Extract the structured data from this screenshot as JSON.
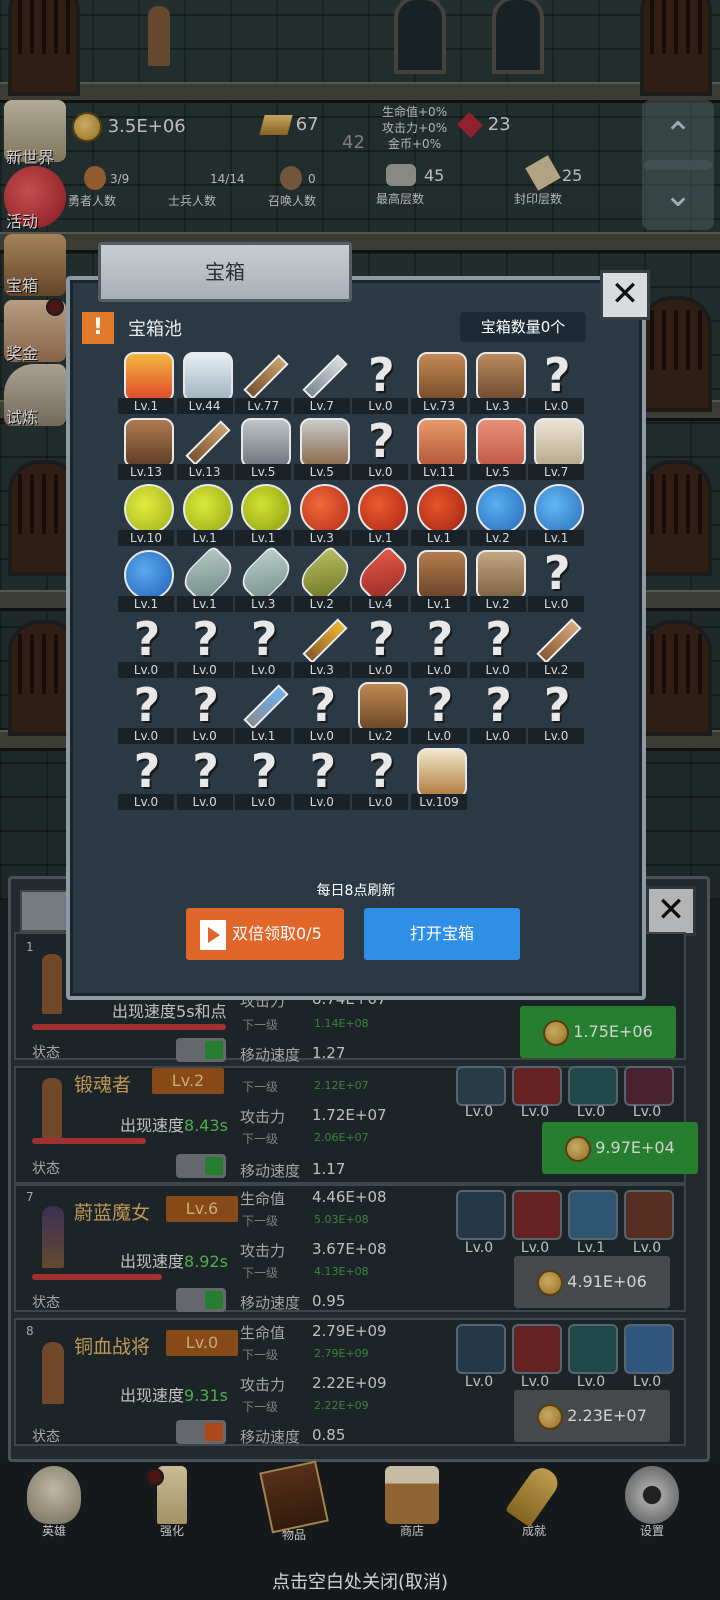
{
  "top_bar": {
    "gold": "3.5E+06",
    "bars": "67",
    "floor_num": "42",
    "gems": "23",
    "bonus_hp": "生命值+0%",
    "bonus_atk": "攻击力+0%",
    "bonus_gold": "金币+0%"
  },
  "counts": {
    "brave_val": "3/9",
    "brave_label": "勇者人数",
    "soldier_val": "14/14",
    "soldier_label": "士兵人数",
    "summon_val": "0",
    "summon_label": "召唤人数",
    "max_floor_val": "45",
    "max_floor_label": "最高层数",
    "seal_floor_val": "25",
    "seal_floor_label": "封印层数"
  },
  "side_menu": [
    "新世界",
    "活动",
    "宝箱",
    "奖金",
    "试炼"
  ],
  "modal": {
    "title": "宝箱",
    "close": "✕",
    "pool_title": "宝箱池",
    "chest_count": "宝箱数量0个",
    "refresh_note": "每日8点刷新",
    "double_btn": "双倍领取0/5",
    "open_btn": "打开宝箱",
    "items": [
      {
        "icon": "crown-icon",
        "lv": "Lv.1",
        "c1": "#f2b640",
        "c2": "#e04a2a"
      },
      {
        "icon": "diamond-icon",
        "lv": "Lv.44",
        "c1": "#e6eef3",
        "c2": "#9fb4c0"
      },
      {
        "icon": "sword-icon",
        "lv": "Lv.77",
        "c1": "#c9a06a",
        "c2": "#7a5230"
      },
      {
        "icon": "sword-icon",
        "lv": "Lv.7",
        "c1": "#d6dadf",
        "c2": "#7f8a92"
      },
      {
        "icon": "unknown-icon",
        "lv": "Lv.0",
        "c1": "#e8e8e8",
        "c2": "#9aa"
      },
      {
        "icon": "armor-icon",
        "lv": "Lv.73",
        "c1": "#c48a56",
        "c2": "#7a4c2a"
      },
      {
        "icon": "armor-icon",
        "lv": "Lv.3",
        "c1": "#b98a5e",
        "c2": "#6d4a2d"
      },
      {
        "icon": "unknown-icon",
        "lv": "Lv.0",
        "c1": "#e8e8e8",
        "c2": "#9aa"
      },
      {
        "icon": "helmet-icon",
        "lv": "Lv.13",
        "c1": "#b07a50",
        "c2": "#5e3d25"
      },
      {
        "icon": "dagger-icon",
        "lv": "Lv.13",
        "c1": "#c9a06a",
        "c2": "#7a5230"
      },
      {
        "icon": "helmet-icon",
        "lv": "Lv.5",
        "c1": "#bfc4c9",
        "c2": "#6e767d"
      },
      {
        "icon": "hammer-icon",
        "lv": "Lv.5",
        "c1": "#c9c9c9",
        "c2": "#8a6a4a"
      },
      {
        "icon": "unknown-icon",
        "lv": "Lv.0",
        "c1": "#e8e8e8",
        "c2": "#9aa"
      },
      {
        "icon": "meat-icon",
        "lv": "Lv.11",
        "c1": "#e89a6a",
        "c2": "#b5573a"
      },
      {
        "icon": "steak-icon",
        "lv": "Lv.5",
        "c1": "#e8907a",
        "c2": "#c05a48"
      },
      {
        "icon": "bread-icon",
        "lv": "Lv.7",
        "c1": "#ece4d4",
        "c2": "#b7a88c"
      },
      {
        "icon": "potion-yellow-icon",
        "lv": "Lv.10",
        "c1": "#e4ec40",
        "c2": "#9cae18"
      },
      {
        "icon": "potion-yellow-icon",
        "lv": "Lv.1",
        "c1": "#dcea3a",
        "c2": "#93a514"
      },
      {
        "icon": "potion-yellow-icon",
        "lv": "Lv.1",
        "c1": "#d2e232",
        "c2": "#8a9c12"
      },
      {
        "icon": "potion-red-icon",
        "lv": "Lv.3",
        "c1": "#f06a3a",
        "c2": "#b52c18"
      },
      {
        "icon": "potion-red-icon",
        "lv": "Lv.1",
        "c1": "#ec5a30",
        "c2": "#a82414"
      },
      {
        "icon": "potion-red-icon",
        "lv": "Lv.1",
        "c1": "#e8542c",
        "c2": "#a02212"
      },
      {
        "icon": "potion-blue-icon",
        "lv": "Lv.2",
        "c1": "#5ab2f0",
        "c2": "#2466b8"
      },
      {
        "icon": "potion-blue-icon",
        "lv": "Lv.1",
        "c1": "#62b8f4",
        "c2": "#2a6cbc"
      },
      {
        "icon": "potion-blue-icon",
        "lv": "Lv.1",
        "c1": "#5aaaf0",
        "c2": "#2260b4"
      },
      {
        "icon": "bottle-icon",
        "lv": "Lv.1",
        "c1": "#b6c8c4",
        "c2": "#6e8a84"
      },
      {
        "icon": "bottle-icon",
        "lv": "Lv.3",
        "c1": "#bcd0cc",
        "c2": "#74908a"
      },
      {
        "icon": "bottle-green-icon",
        "lv": "Lv.2",
        "c1": "#b8c060",
        "c2": "#6c7426"
      },
      {
        "icon": "bottle-red-icon",
        "lv": "Lv.4",
        "c1": "#e45a4a",
        "c2": "#9a2a22"
      },
      {
        "icon": "boot-icon",
        "lv": "Lv.1",
        "c1": "#b47c4e",
        "c2": "#6a4428"
      },
      {
        "icon": "boot-icon",
        "lv": "Lv.2",
        "c1": "#c4a682",
        "c2": "#7c6244"
      },
      {
        "icon": "unknown-icon",
        "lv": "Lv.0",
        "c1": "#e8e8e8",
        "c2": "#9aa"
      },
      {
        "icon": "unknown-icon",
        "lv": "Lv.0",
        "c1": "#e8e8e8",
        "c2": "#9aa"
      },
      {
        "icon": "unknown-icon",
        "lv": "Lv.0",
        "c1": "#e8e8e8",
        "c2": "#9aa"
      },
      {
        "icon": "unknown-icon",
        "lv": "Lv.0",
        "c1": "#e8e8e8",
        "c2": "#9aa"
      },
      {
        "icon": "torch-icon",
        "lv": "Lv.3",
        "c1": "#f2b62a",
        "c2": "#8a5a2a"
      },
      {
        "icon": "unknown-icon",
        "lv": "Lv.0",
        "c1": "#e8e8e8",
        "c2": "#9aa"
      },
      {
        "icon": "unknown-icon",
        "lv": "Lv.0",
        "c1": "#e8e8e8",
        "c2": "#9aa"
      },
      {
        "icon": "unknown-icon",
        "lv": "Lv.0",
        "c1": "#e8e8e8",
        "c2": "#9aa"
      },
      {
        "icon": "staff-icon",
        "lv": "Lv.2",
        "c1": "#d6a878",
        "c2": "#8a5a34"
      },
      {
        "icon": "unknown-icon",
        "lv": "Lv.0",
        "c1": "#e8e8e8",
        "c2": "#9aa"
      },
      {
        "icon": "unknown-icon",
        "lv": "Lv.0",
        "c1": "#e8e8e8",
        "c2": "#9aa"
      },
      {
        "icon": "wand-icon",
        "lv": "Lv.1",
        "c1": "#6ab0f0",
        "c2": "#8a8f96"
      },
      {
        "icon": "unknown-icon",
        "lv": "Lv.0",
        "c1": "#e8e8e8",
        "c2": "#9aa"
      },
      {
        "icon": "backpack-icon",
        "lv": "Lv.2",
        "c1": "#c08a52",
        "c2": "#6c4626"
      },
      {
        "icon": "unknown-icon",
        "lv": "Lv.0",
        "c1": "#e8e8e8",
        "c2": "#9aa"
      },
      {
        "icon": "unknown-icon",
        "lv": "Lv.0",
        "c1": "#e8e8e8",
        "c2": "#9aa"
      },
      {
        "icon": "unknown-icon",
        "lv": "Lv.0",
        "c1": "#e8e8e8",
        "c2": "#9aa"
      },
      {
        "icon": "unknown-icon",
        "lv": "Lv.0",
        "c1": "#e8e8e8",
        "c2": "#9aa"
      },
      {
        "icon": "unknown-icon",
        "lv": "Lv.0",
        "c1": "#e8e8e8",
        "c2": "#9aa"
      },
      {
        "icon": "unknown-icon",
        "lv": "Lv.0",
        "c1": "#e8e8e8",
        "c2": "#9aa"
      },
      {
        "icon": "unknown-icon",
        "lv": "Lv.0",
        "c1": "#e8e8e8",
        "c2": "#9aa"
      },
      {
        "icon": "unknown-icon",
        "lv": "Lv.0",
        "c1": "#e8e8e8",
        "c2": "#9aa"
      },
      {
        "icon": "beer-icon",
        "lv": "Lv.109",
        "c1": "#f2e6c8",
        "c2": "#b07a3e"
      }
    ]
  },
  "heroes": [
    {
      "rank": "1",
      "name": "",
      "speed_label": "出现速度",
      "speed_val": "5s和点",
      "atk_label": "攻击力",
      "atk": "8.74E+07",
      "atk_next_label": "下一级",
      "atk_next": "1.14E+08",
      "move_label": "移动速度",
      "move": "1.27",
      "status_label": "状态",
      "price": "1.75E+06"
    },
    {
      "rank": "",
      "name": "锻魂者",
      "level": "Lv.2",
      "speed_label": "出现速度",
      "speed_val": "8.43s",
      "hp_next_label": "下一级",
      "hp_next": "2.12E+07",
      "atk_label": "攻击力",
      "atk": "1.72E+07",
      "atk_next_label": "下一级",
      "atk_next": "2.06E+07",
      "move_label": "移动速度",
      "move": "1.17",
      "status_label": "状态",
      "skills": [
        "Lv.0",
        "Lv.0",
        "Lv.0",
        "Lv.0"
      ],
      "price": "9.97E+04"
    },
    {
      "rank": "7",
      "name": "蔚蓝魔女",
      "level": "Lv.6",
      "speed_label": "出现速度",
      "speed_val": "8.92s",
      "hp_label": "生命值",
      "hp": "4.46E+08",
      "hp_next_label": "下一级",
      "hp_next": "5.03E+08",
      "atk_label": "攻击力",
      "atk": "3.67E+08",
      "atk_next_label": "下一级",
      "atk_next": "4.13E+08",
      "move_label": "移动速度",
      "move": "0.95",
      "status_label": "状态",
      "skills": [
        "Lv.0",
        "Lv.0",
        "Lv.1",
        "Lv.0"
      ],
      "price": "4.91E+06"
    },
    {
      "rank": "8",
      "name": "铜血战将",
      "level": "Lv.0",
      "speed_label": "出现速度",
      "speed_val": "9.31s",
      "hp_label": "生命值",
      "hp": "2.79E+09",
      "hp_next_label": "下一级",
      "hp_next": "2.79E+09",
      "atk_label": "攻击力",
      "atk": "2.22E+09",
      "atk_next_label": "下一级",
      "atk_next": "2.22E+09",
      "move_label": "移动速度",
      "move": "0.85",
      "status_label": "状态",
      "skills": [
        "Lv.0",
        "Lv.0",
        "Lv.0",
        "Lv.0"
      ],
      "price": "2.23E+07"
    }
  ],
  "bottom_nav": [
    "英雄",
    "强化",
    "物品",
    "商店",
    "成就",
    "设置"
  ],
  "footer_hint": "点击空白处关闭(取消)",
  "colors": {
    "accent_orange": "#e0662a",
    "accent_blue": "#2f8fe6",
    "buy_green": "#2f9a3a",
    "buy_gray": "#55595c"
  }
}
